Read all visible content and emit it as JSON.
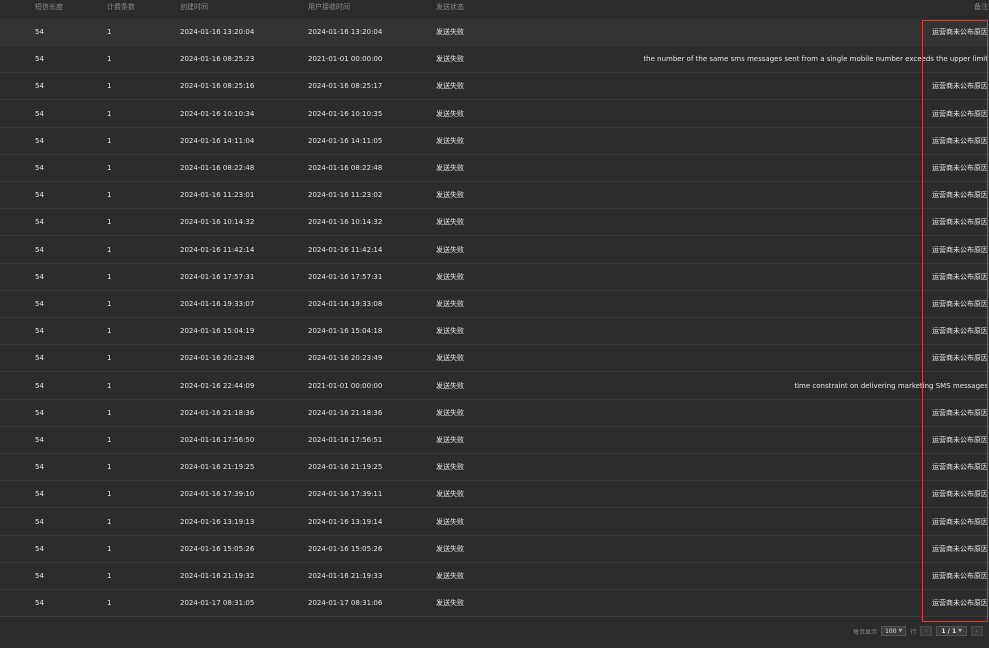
{
  "table": {
    "headers": {
      "length": "短信长度",
      "count": "计费条数",
      "created": "创建时间",
      "received": "用户接收时间",
      "status": "发送状态",
      "note": "备注"
    },
    "rows": [
      {
        "length": "54",
        "count": "1",
        "created": "2024-01-16 13:20:04",
        "received": "2024-01-16 13:20:04",
        "status": "发送失败",
        "note": "运营商未公布原因"
      },
      {
        "length": "54",
        "count": "1",
        "created": "2024-01-16 08:25:23",
        "received": "2021-01-01 00:00:00",
        "status": "发送失败",
        "note": "the number of the same sms messages sent from a single mobile number exceeds the upper limit"
      },
      {
        "length": "54",
        "count": "1",
        "created": "2024-01-16 08:25:16",
        "received": "2024-01-16 08:25:17",
        "status": "发送失败",
        "note": "运营商未公布原因"
      },
      {
        "length": "54",
        "count": "1",
        "created": "2024-01-16 10:10:34",
        "received": "2024-01-16 10:10:35",
        "status": "发送失败",
        "note": "运营商未公布原因"
      },
      {
        "length": "54",
        "count": "1",
        "created": "2024-01-16 14:11:04",
        "received": "2024-01-16 14:11:05",
        "status": "发送失败",
        "note": "运营商未公布原因"
      },
      {
        "length": "54",
        "count": "1",
        "created": "2024-01-16 08:22:48",
        "received": "2024-01-16 08:22:48",
        "status": "发送失败",
        "note": "运营商未公布原因"
      },
      {
        "length": "54",
        "count": "1",
        "created": "2024-01-16 11:23:01",
        "received": "2024-01-16 11:23:02",
        "status": "发送失败",
        "note": "运营商未公布原因"
      },
      {
        "length": "54",
        "count": "1",
        "created": "2024-01-16 10:14:32",
        "received": "2024-01-16 10:14:32",
        "status": "发送失败",
        "note": "运营商未公布原因"
      },
      {
        "length": "54",
        "count": "1",
        "created": "2024-01-16 11:42:14",
        "received": "2024-01-16 11:42:14",
        "status": "发送失败",
        "note": "运营商未公布原因"
      },
      {
        "length": "54",
        "count": "1",
        "created": "2024-01-16 17:57:31",
        "received": "2024-01-16 17:57:31",
        "status": "发送失败",
        "note": "运营商未公布原因"
      },
      {
        "length": "54",
        "count": "1",
        "created": "2024-01-16 19:33:07",
        "received": "2024-01-16 19:33:08",
        "status": "发送失败",
        "note": "运营商未公布原因"
      },
      {
        "length": "54",
        "count": "1",
        "created": "2024-01-16 15:04:19",
        "received": "2024-01-16 15:04:18",
        "status": "发送失败",
        "note": "运营商未公布原因"
      },
      {
        "length": "54",
        "count": "1",
        "created": "2024-01-16 20:23:48",
        "received": "2024-01-16 20:23:49",
        "status": "发送失败",
        "note": "运营商未公布原因"
      },
      {
        "length": "54",
        "count": "1",
        "created": "2024-01-16 22:44:09",
        "received": "2021-01-01 00:00:00",
        "status": "发送失败",
        "note": "time constraint on delivering marketing SMS messages"
      },
      {
        "length": "54",
        "count": "1",
        "created": "2024-01-16 21:18:36",
        "received": "2024-01-16 21:18:36",
        "status": "发送失败",
        "note": "运营商未公布原因"
      },
      {
        "length": "54",
        "count": "1",
        "created": "2024-01-16 17:56:50",
        "received": "2024-01-16 17:56:51",
        "status": "发送失败",
        "note": "运营商未公布原因"
      },
      {
        "length": "54",
        "count": "1",
        "created": "2024-01-16 21:19:25",
        "received": "2024-01-16 21:19:25",
        "status": "发送失败",
        "note": "运营商未公布原因"
      },
      {
        "length": "54",
        "count": "1",
        "created": "2024-01-16 17:39:10",
        "received": "2024-01-16 17:39:11",
        "status": "发送失败",
        "note": "运营商未公布原因"
      },
      {
        "length": "54",
        "count": "1",
        "created": "2024-01-16 13:19:13",
        "received": "2024-01-16 13:19:14",
        "status": "发送失败",
        "note": "运营商未公布原因"
      },
      {
        "length": "54",
        "count": "1",
        "created": "2024-01-16 15:05:26",
        "received": "2024-01-16 15:05:26",
        "status": "发送失败",
        "note": "运营商未公布原因"
      },
      {
        "length": "54",
        "count": "1",
        "created": "2024-01-16 21:19:32",
        "received": "2024-01-16 21:19:33",
        "status": "发送失败",
        "note": "运营商未公布原因"
      },
      {
        "length": "54",
        "count": "1",
        "created": "2024-01-17 08:31:05",
        "received": "2024-01-17 08:31:06",
        "status": "发送失败",
        "note": "运营商未公布原因"
      }
    ]
  },
  "pagination": {
    "per_page_label": "每页显示",
    "per_page_value": "100",
    "rows_suffix": "行",
    "page_value": "1 / 1",
    "prev_icon": "chevron-left-icon",
    "next_icon": "chevron-right-icon"
  },
  "colors": {
    "background": "#2b2b2b",
    "highlight_border": "#e53935"
  }
}
